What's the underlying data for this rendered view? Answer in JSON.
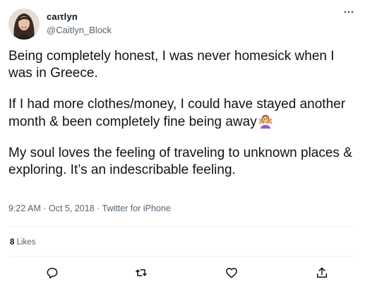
{
  "author": {
    "display_name": "caιτlyn",
    "handle": "@Caitlyn_Block"
  },
  "tweet": {
    "paragraphs": [
      "Being completely honest, I was never homesick when I was in Greece.",
      "If I had more clothes/money, I could have stayed another month & been completely fine being away",
      "My soul loves the feeling of traveling to unknown places & exploring.  It’s an indescribable feeling."
    ],
    "emoji": "person-gesturing-no-emoji"
  },
  "meta": {
    "time": "9:22 AM",
    "separator": " · ",
    "date": "Oct 5, 2018",
    "source": "Twitter for iPhone"
  },
  "stats": {
    "likes_count": "8",
    "likes_label": "Likes"
  },
  "icons": {
    "more": "more-options-icon",
    "reply": "reply-icon",
    "retweet": "retweet-icon",
    "like": "like-icon",
    "share": "share-icon"
  },
  "colors": {
    "text": "#0f1419",
    "secondary": "#536471",
    "divider": "#eff3f4"
  }
}
